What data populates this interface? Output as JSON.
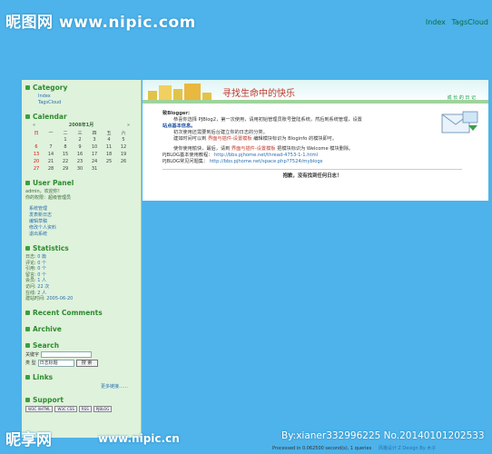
{
  "watermark": {
    "top": "昵图网 www.nipic.com",
    "bottom": "昵享网",
    "bottom_url": "www.nipic.cn",
    "bottom_id": "By:xianer332996225 No.20140101202533"
  },
  "topnav": {
    "index": "Index",
    "tags": "TagsCloud"
  },
  "sidebar": {
    "category": {
      "title": "Category",
      "items": [
        "Index",
        "TagsCloud"
      ]
    },
    "calendar": {
      "title": "Calendar",
      "header": "2008年1月",
      "weekdays": [
        "日",
        "一",
        "二",
        "三",
        "四",
        "五",
        "六"
      ],
      "rows": [
        [
          "",
          "",
          "1",
          "2",
          "3",
          "4",
          "5"
        ],
        [
          "6",
          "7",
          "8",
          "9",
          "10",
          "11",
          "12"
        ],
        [
          "13",
          "14",
          "15",
          "16",
          "17",
          "18",
          "19"
        ],
        [
          "20",
          "21",
          "22",
          "23",
          "24",
          "25",
          "26"
        ],
        [
          "27",
          "28",
          "29",
          "30",
          "31",
          "",
          ""
        ]
      ]
    },
    "user": {
      "title": "User Panel",
      "welcome": "admin，欢迎你！",
      "role": "你的权限：超级管理员",
      "links": [
        "系统管理",
        "发表新日志",
        "编辑草稿",
        "修改个人资料",
        "退出系统"
      ]
    },
    "stats": {
      "title": "Statistics",
      "lines": [
        {
          "label": "日志:",
          "value": "0 篇"
        },
        {
          "label": "评论:",
          "value": "0 个"
        },
        {
          "label": "引用:",
          "value": "0 个"
        },
        {
          "label": "留言:",
          "value": "0 个"
        },
        {
          "label": "会员:",
          "value": "1 人"
        },
        {
          "label": "访问:",
          "value": "22 次"
        },
        {
          "label": "在线:",
          "value": "2 人"
        },
        {
          "label": "建站时间:",
          "value": "2005-06-20"
        }
      ]
    },
    "recent_comments": "Recent Comments",
    "archive": "Archive",
    "search": {
      "title": "Search",
      "keyword_label": "关键字",
      "type_label": "类 型",
      "select_value": "日志标题",
      "button": "搜 索"
    },
    "links": {
      "title": "Links",
      "more": "更多链接……"
    },
    "support": {
      "title": "Support",
      "badges": [
        "W3C XHTML",
        "W3C CSS",
        "RSS",
        "PJBLOG"
      ]
    }
  },
  "main": {
    "banner_title": "寻找生命中的快乐",
    "banner_sub": "成 长 的 日 记",
    "greeting": "致Blogger:",
    "p1": "恭喜你选择 PJBlog2，第一次使用，请用初始管理员账号登陆系统，然后到系统管理，设置",
    "p1b": "站点基本信息。",
    "p2": "初次使用还需要到后台建立你的日志的分类。",
    "p3_pre": "建如时间可以到",
    "p3_link": "界面与插件-设置模板",
    "p3_post": "编辑模块标识为 Bloginfo 的模块即可。",
    "p4_pre": "使你使用愉快，最后，请到",
    "p4_link": "界面与插件-设置模板",
    "p4_post": "把模块标识为 Welcome 模块删除。",
    "l1_label": "PJBLOG基本使用教程：",
    "l1_url": "http://bbs.pjhome.net/thread-4753-1-1.html",
    "l2_label": "PJBLOG常见问题集：",
    "l2_url": "http://bbs.pjhome.net/space.php?7524/myblogs",
    "empty": "抱歉，没有找到任何日志！"
  },
  "footer": {
    "text": "Processed in 0.062500 second(s), 1 queries",
    "theme": "风格设计 Z Design By 木子"
  }
}
